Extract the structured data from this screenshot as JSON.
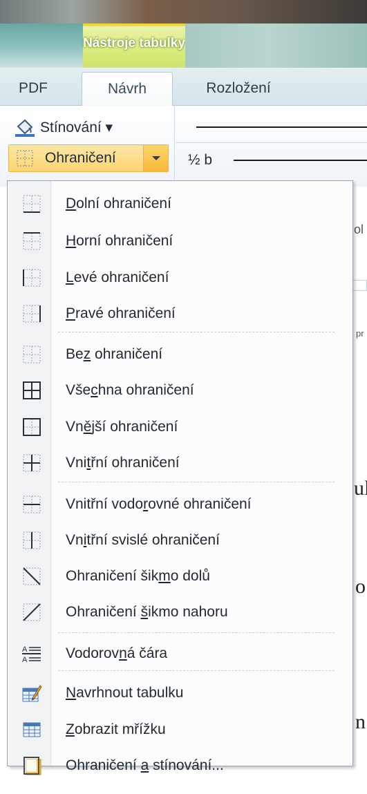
{
  "ribbon": {
    "contextual_group": "Nástroje tabulky",
    "tabs": [
      "PDF",
      "Návrh",
      "Rozložení"
    ],
    "shading_button": "Stínování ▾",
    "borders_button": "Ohraničení",
    "line_weight": "½ b"
  },
  "menu": {
    "items": [
      {
        "pre": "",
        "u": "D",
        "post": "olní ohraničení",
        "icon": "bottom-border-icon"
      },
      {
        "pre": "",
        "u": "H",
        "post": "orní ohraničení",
        "icon": "top-border-icon"
      },
      {
        "pre": "",
        "u": "L",
        "post": "evé ohraničení",
        "icon": "left-border-icon"
      },
      {
        "pre": "",
        "u": "P",
        "post": "ravé ohraničení",
        "icon": "right-border-icon"
      },
      {
        "pre": "Be",
        "u": "z",
        "post": " ohraničení",
        "icon": "no-border-icon"
      },
      {
        "pre": "Vše",
        "u": "c",
        "post": "hna ohraničení",
        "icon": "all-borders-icon"
      },
      {
        "pre": "Vn",
        "u": "ě",
        "post": "jší ohraničení",
        "icon": "outside-borders-icon"
      },
      {
        "pre": "Vni",
        "u": "t",
        "post": "řní ohraničení",
        "icon": "inside-borders-icon"
      },
      {
        "pre": "Vnitřní vodo",
        "u": "r",
        "post": "ovné ohraničení",
        "icon": "inside-horizontal-border-icon"
      },
      {
        "pre": "Vn",
        "u": "i",
        "post": "třní svislé ohraničení",
        "icon": "inside-vertical-border-icon"
      },
      {
        "pre": "Ohraničení šik",
        "u": "m",
        "post": "o dolů",
        "icon": "diagonal-down-border-icon"
      },
      {
        "pre": "Ohraničení ",
        "u": "š",
        "post": "ikmo nahoru",
        "icon": "diagonal-up-border-icon"
      },
      {
        "pre": "Vodorov",
        "u": "n",
        "post": "á čára",
        "icon": "horizontal-line-icon"
      },
      {
        "pre": "",
        "u": "N",
        "post": "avrhnout tabulku",
        "icon": "draw-table-icon"
      },
      {
        "pre": "",
        "u": "Z",
        "post": "obrazit mřížku",
        "icon": "view-gridlines-icon"
      },
      {
        "pre": "Ohraničení ",
        "u": "a",
        "post": " stínování...",
        "icon": "borders-and-shading-icon"
      }
    ]
  },
  "document": {
    "partial_glyphs": [
      "ol",
      "pr",
      "ul",
      "o",
      "n"
    ]
  }
}
